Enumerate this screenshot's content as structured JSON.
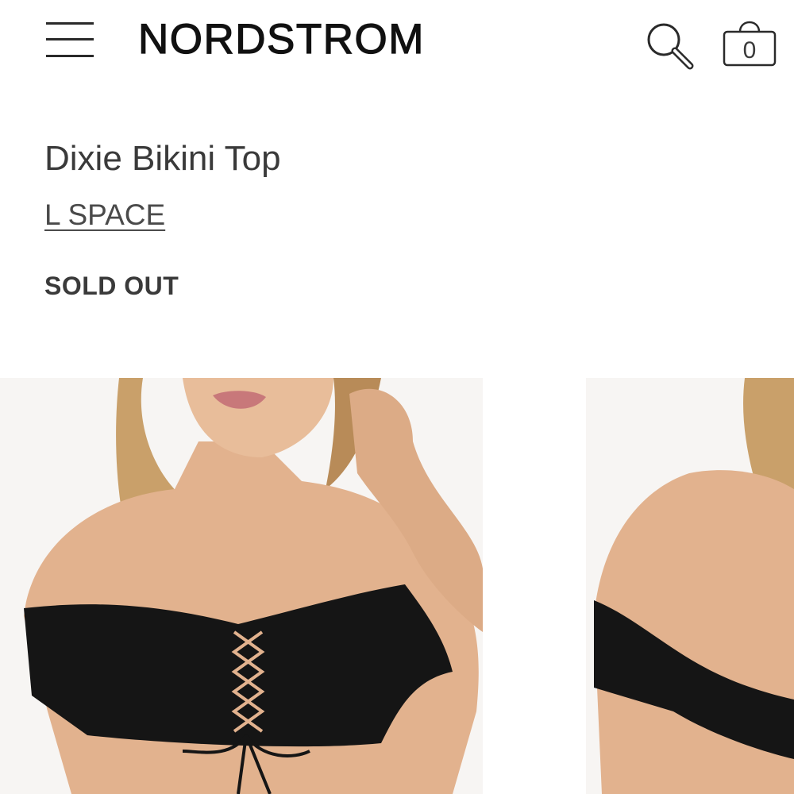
{
  "header": {
    "logo": "NORDSTROM",
    "bag_count": "0"
  },
  "product": {
    "title": "Dixie Bikini Top",
    "brand": "L SPACE",
    "status": "SOLD OUT"
  },
  "icons": {
    "menu": "hamburger-menu-icon",
    "search": "search-icon",
    "bag": "shopping-bag-icon"
  },
  "colors": {
    "text": "#3a3a3a",
    "logo": "#111111",
    "swimsuit": "#151515",
    "skin": "#e6b692"
  }
}
